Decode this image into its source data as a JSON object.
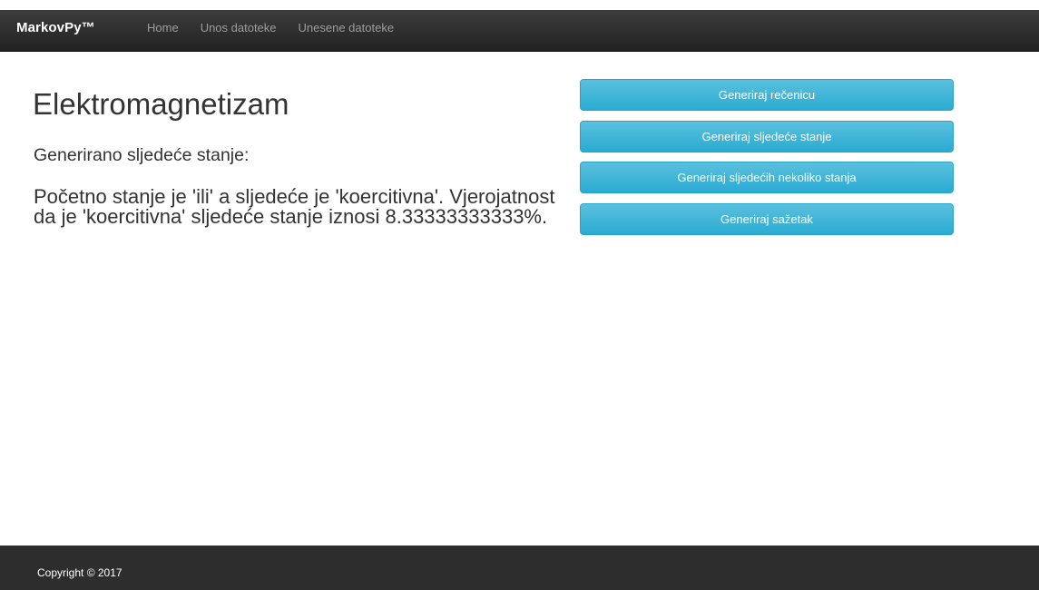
{
  "navbar": {
    "brand": "MarkovPy™",
    "links": [
      {
        "label": "Home"
      },
      {
        "label": "Unos datoteke"
      },
      {
        "label": "Unesene datoteke"
      }
    ]
  },
  "main": {
    "title": "Elektromagnetizam",
    "subtitle": "Generirano sljedeće stanje:",
    "result": "Početno stanje je 'ili' a sljedeće je 'koercitivna'. Vjerojatnost da je 'koercitivna' sljedeće stanje iznosi 8.33333333333%."
  },
  "actions": {
    "buttons": [
      {
        "label": "Generiraj rečenicu"
      },
      {
        "label": "Generiraj sljedeće stanje"
      },
      {
        "label": "Generiraj sljedećih nekoliko stanja"
      },
      {
        "label": "Generiraj sažetak"
      }
    ]
  },
  "footer": {
    "copyright": "Copyright © 2017"
  },
  "colors": {
    "navbar": "#222222",
    "button": "#5bc0de",
    "footer": "#2d2d2d"
  }
}
